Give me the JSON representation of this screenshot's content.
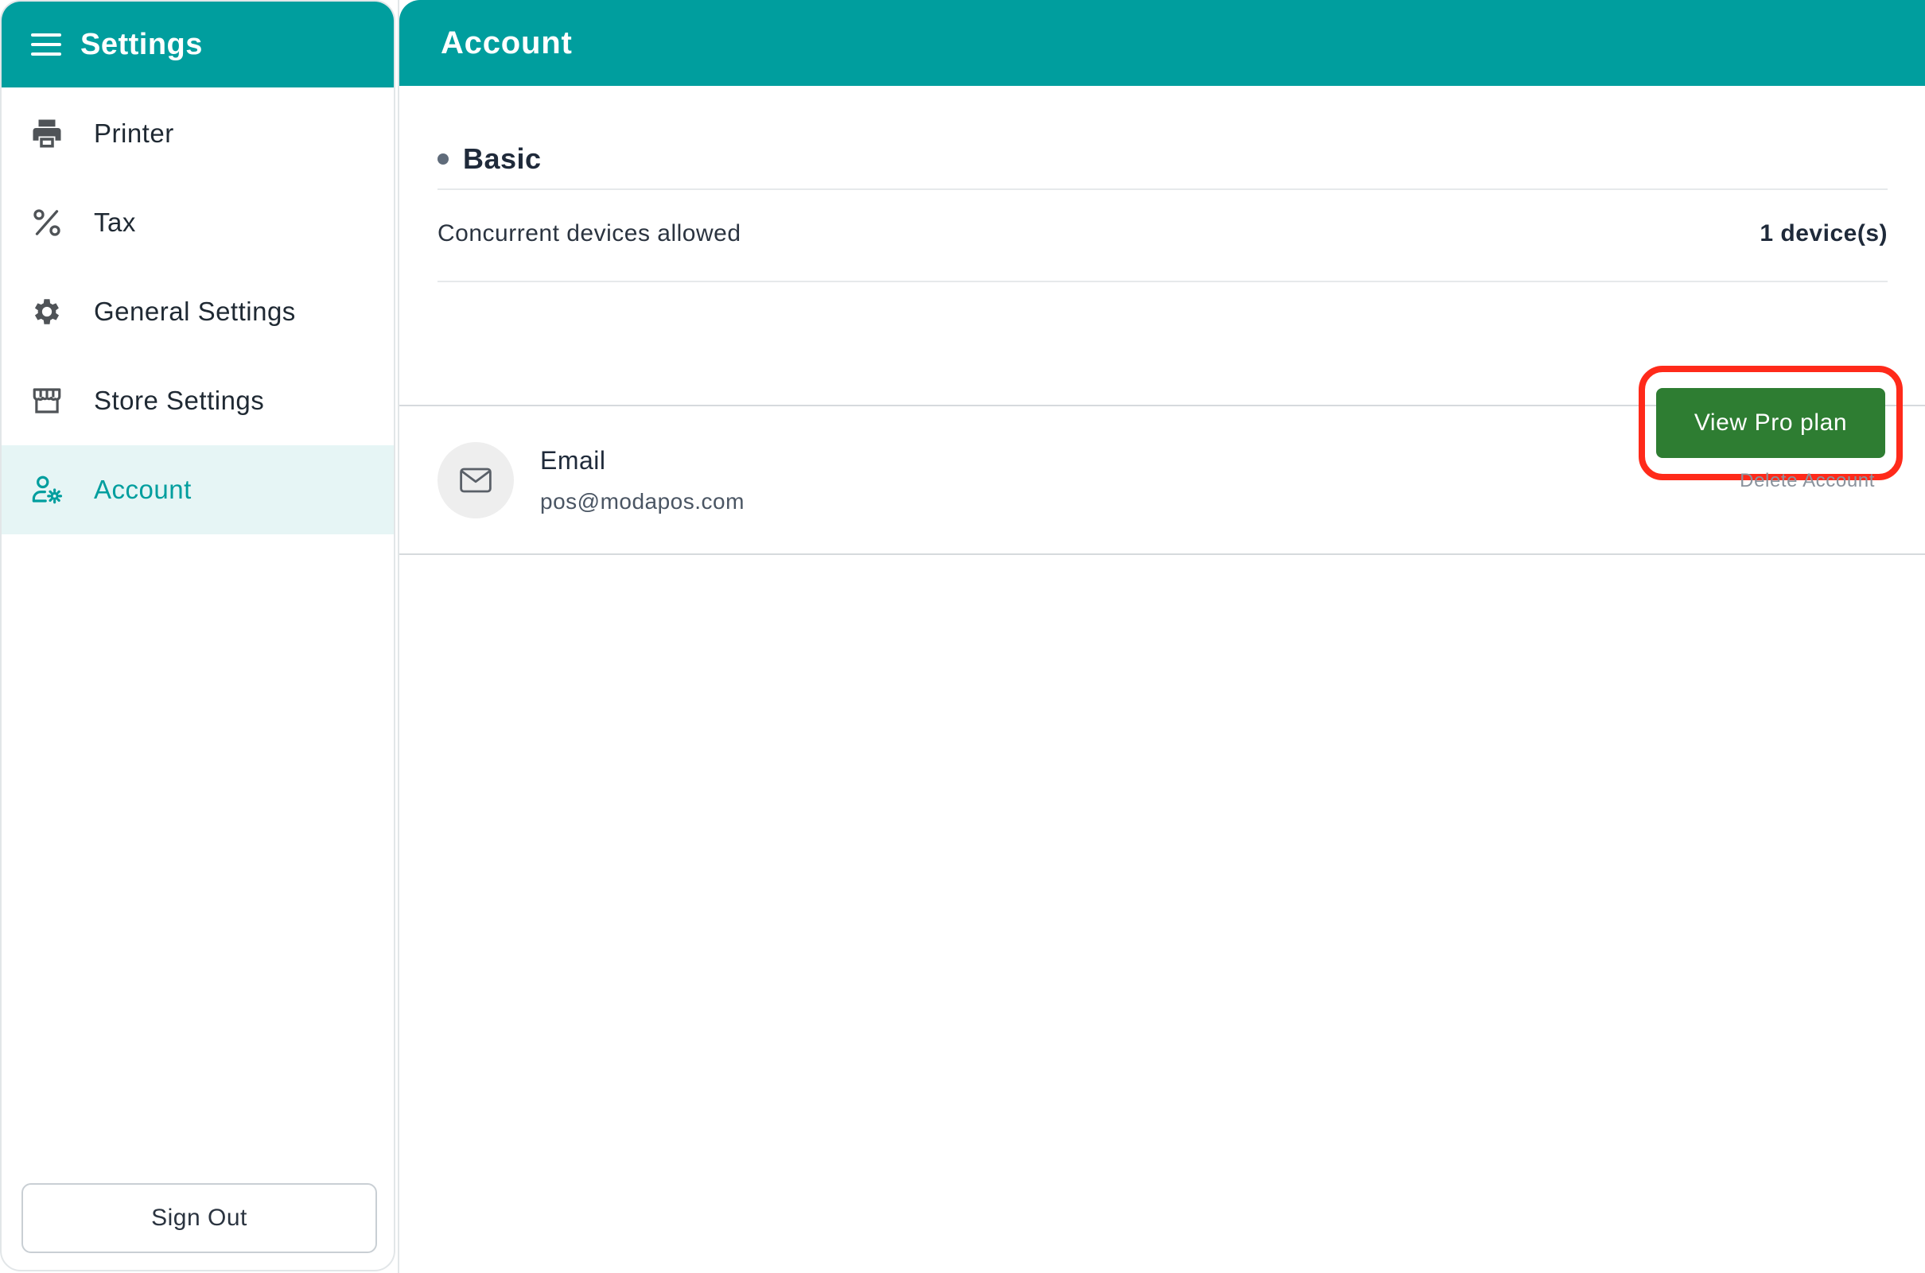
{
  "sidebar": {
    "title": "Settings",
    "menu_icon": "hamburger-menu-icon",
    "items": [
      {
        "label": "Printer",
        "icon": "printer-icon",
        "active": false
      },
      {
        "label": "Tax",
        "icon": "percent-icon",
        "active": false
      },
      {
        "label": "General Settings",
        "icon": "gear-icon",
        "active": false
      },
      {
        "label": "Store Settings",
        "icon": "storefront-icon",
        "active": false
      },
      {
        "label": "Account",
        "icon": "user-gear-icon",
        "active": true
      }
    ],
    "signout_label": "Sign Out"
  },
  "main": {
    "title": "Account",
    "plan": {
      "name": "Basic",
      "devices_label": "Concurrent devices allowed",
      "devices_value": "1 device(s)",
      "pro_button_label": "View Pro plan"
    },
    "email": {
      "icon": "mail-icon",
      "label": "Email",
      "value": "pos@modapos.com",
      "delete_label": "Delete Account"
    }
  },
  "colors": {
    "header": "#009e9e",
    "active_bg": "#e6f5f5",
    "pro_button": "#2e7d32",
    "highlight": "#ff2a1a"
  }
}
